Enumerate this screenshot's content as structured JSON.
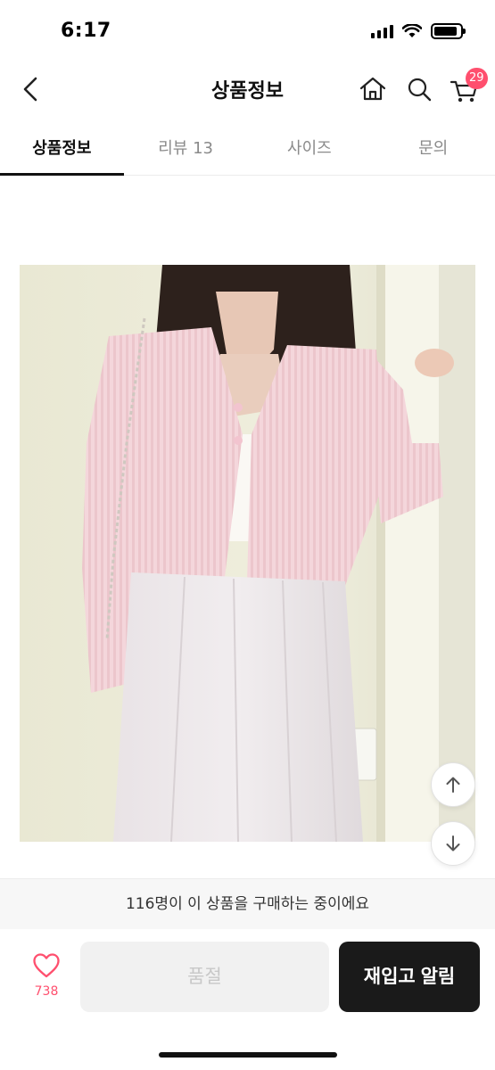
{
  "status_bar": {
    "time": "6:17",
    "battery_level": 0.9
  },
  "header": {
    "title": "상품정보",
    "back_icon": "chevron-left-icon",
    "home_icon": "home-icon",
    "search_icon": "search-icon",
    "cart_icon": "cart-icon",
    "cart_count": "29",
    "badge_color": "#ff4f6e"
  },
  "tabs": [
    {
      "label": "상품정보",
      "active": true
    },
    {
      "label": "리뷰 13",
      "active": false
    },
    {
      "label": "사이즈",
      "active": false
    },
    {
      "label": "문의",
      "active": false
    }
  ],
  "product": {
    "image_desc_icon": "product-photo",
    "cardigan_color": "#f3d4d9"
  },
  "scroll": {
    "up_icon": "arrow-up-icon",
    "down_icon": "arrow-down-icon"
  },
  "bottom": {
    "buyer_message": "116명이 이 상품을 구매하는 중이에요",
    "like_icon": "heart-icon",
    "like_count": "738",
    "soldout_label": "품절",
    "restock_label": "재입고 알림",
    "accent_color": "#ff4f6e",
    "dark_button_color": "#1a1a1a"
  }
}
